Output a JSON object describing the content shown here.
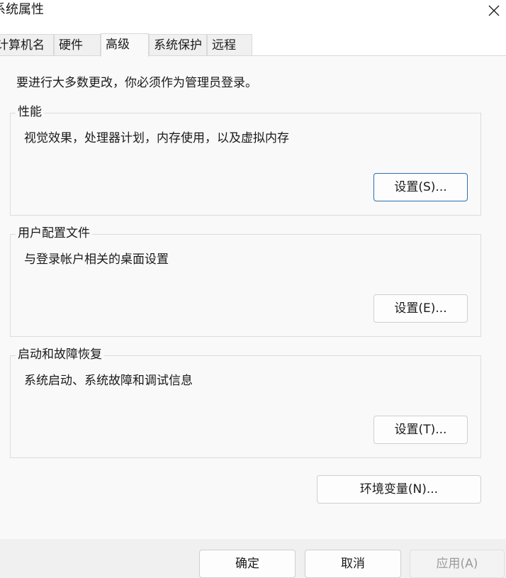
{
  "window": {
    "title": "系统属性",
    "close_icon": "close-icon"
  },
  "tabs": [
    {
      "label": "计算机名",
      "active": false
    },
    {
      "label": "硬件",
      "active": false
    },
    {
      "label": "高级",
      "active": true
    },
    {
      "label": "系统保护",
      "active": false
    },
    {
      "label": "远程",
      "active": false
    }
  ],
  "advanced": {
    "admin_notice": "要进行大多数更改，你必须作为管理员登录。",
    "performance": {
      "title": "性能",
      "description": "视觉效果，处理器计划，内存使用，以及虚拟内存",
      "button": "设置(S)..."
    },
    "user_profiles": {
      "title": "用户配置文件",
      "description": "与登录帐户相关的桌面设置",
      "button": "设置(E)..."
    },
    "startup_recovery": {
      "title": "启动和故障恢复",
      "description": "系统启动、系统故障和调试信息",
      "button": "设置(T)..."
    },
    "env_vars_button": "环境变量(N)..."
  },
  "footer": {
    "ok": "确定",
    "cancel": "取消",
    "apply": "应用(A)"
  }
}
